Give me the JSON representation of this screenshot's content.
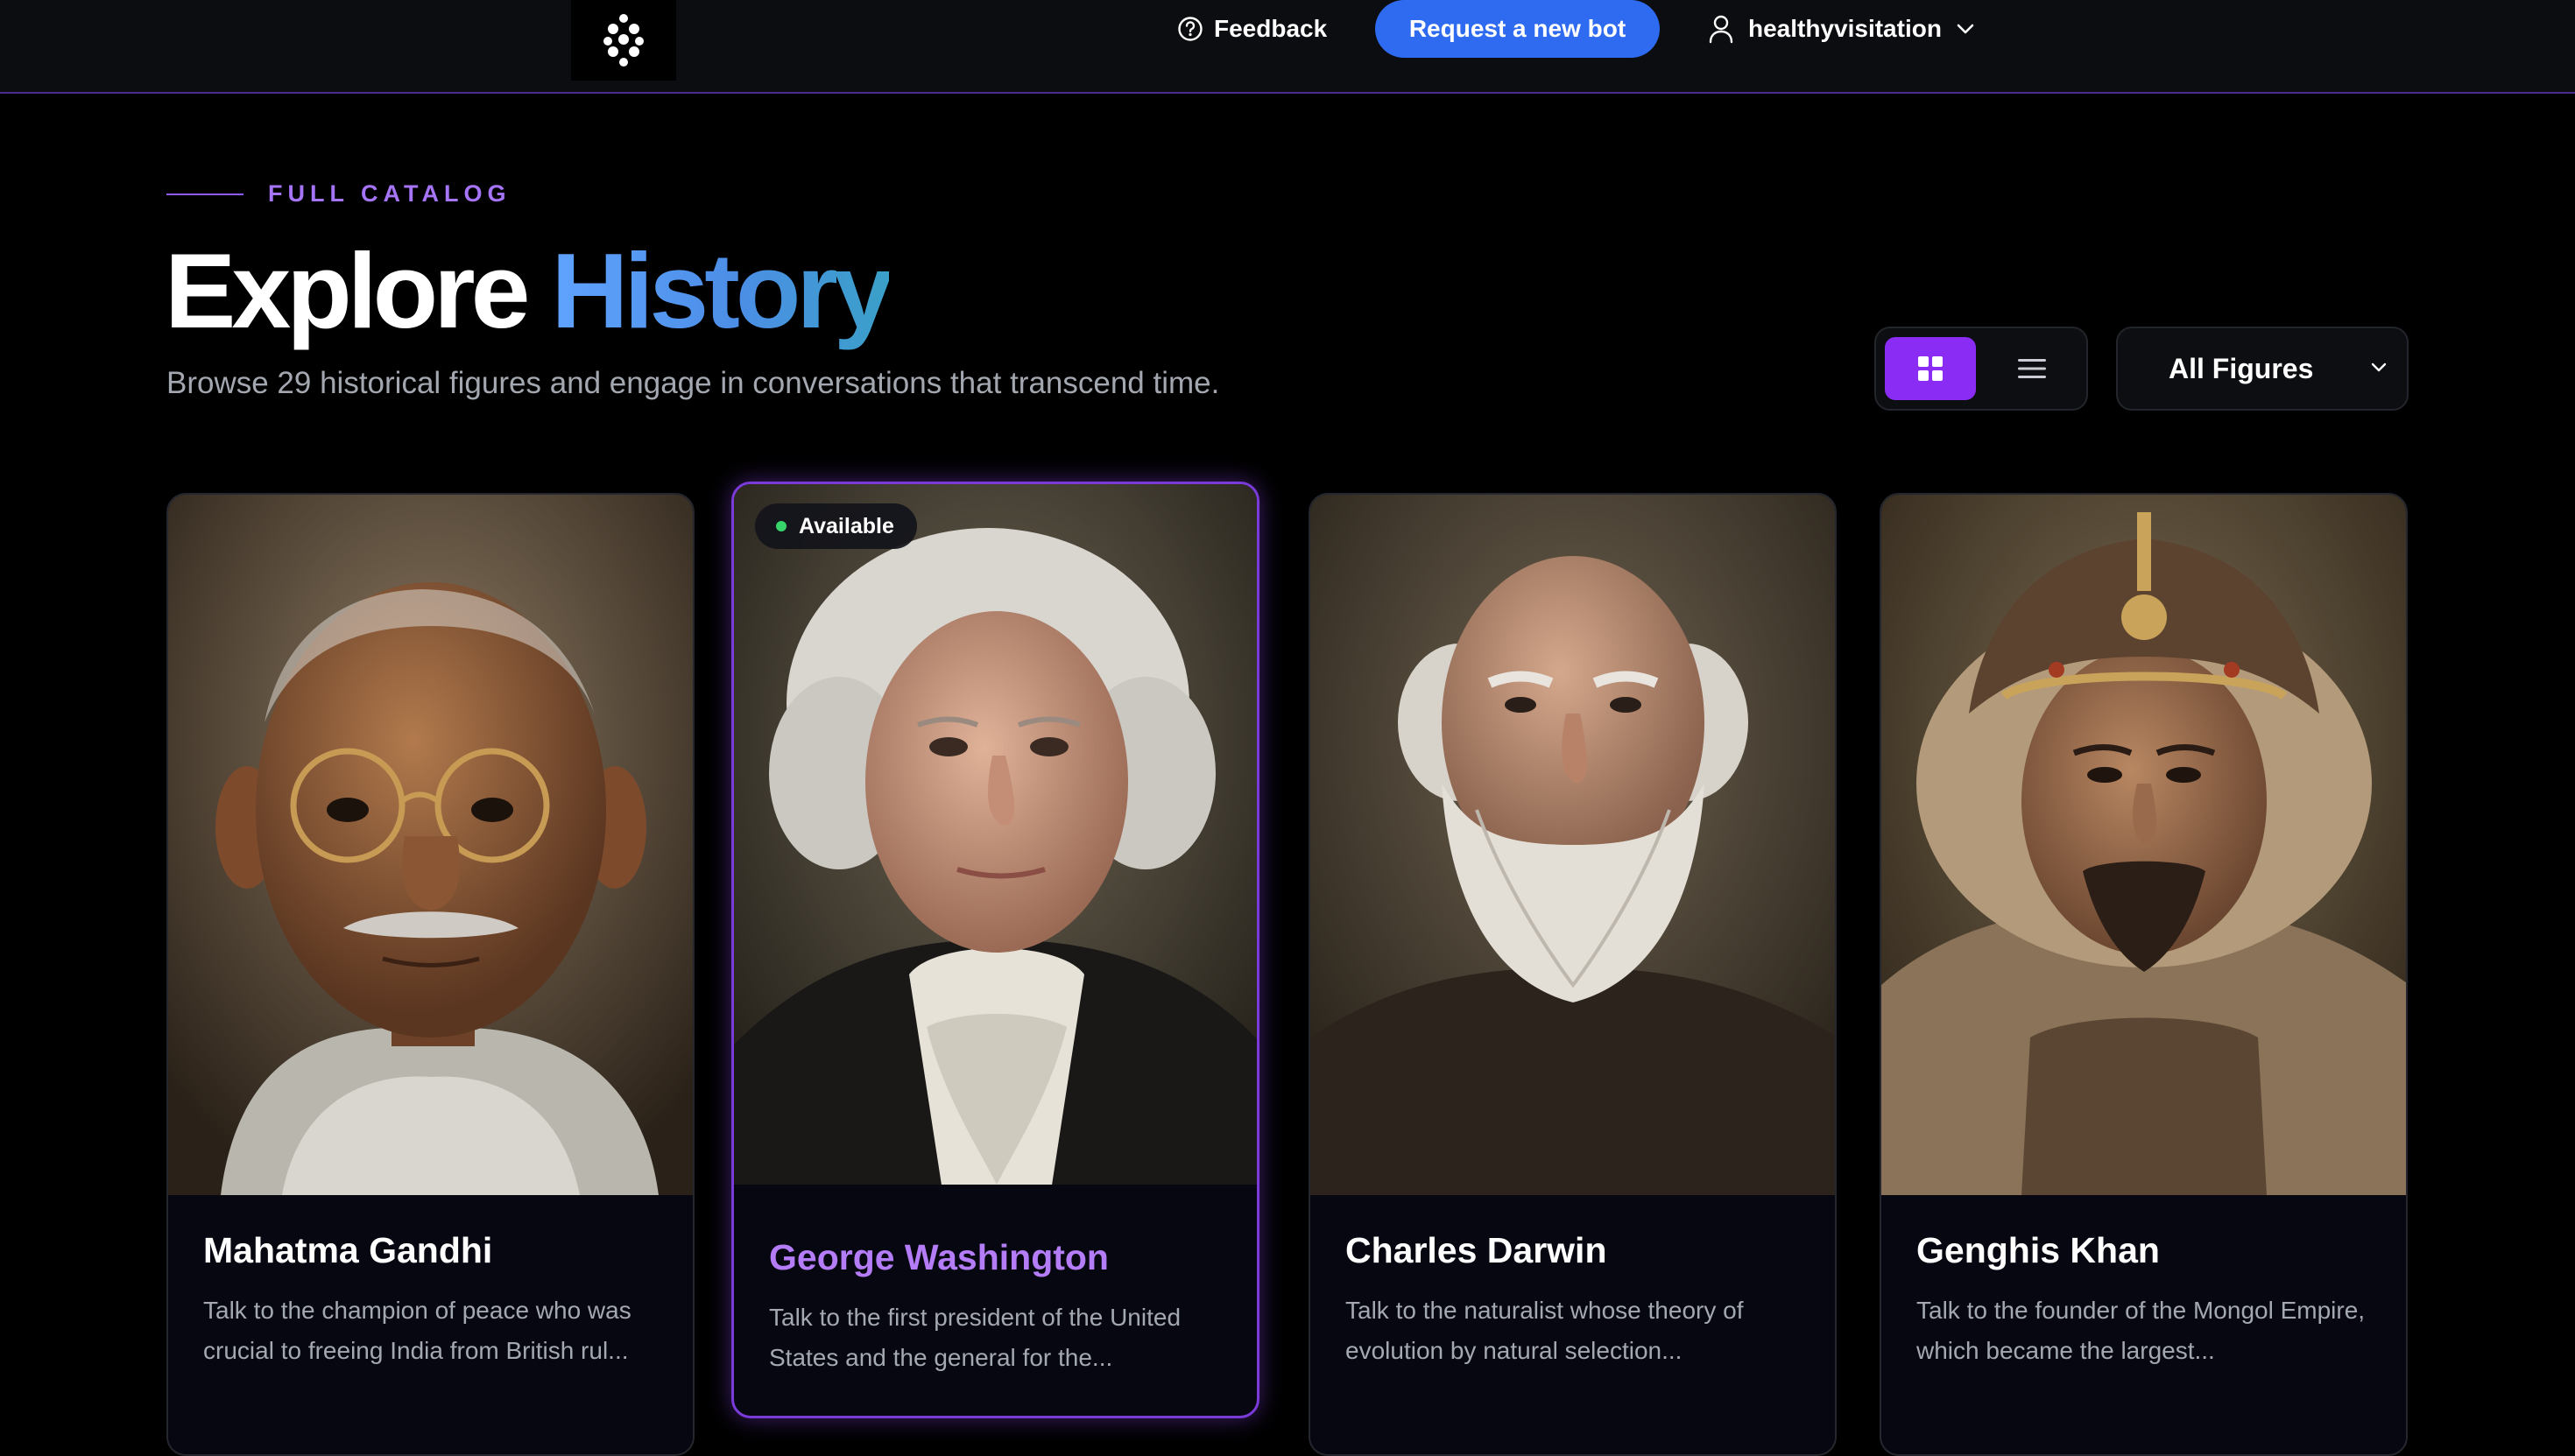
{
  "nav": {
    "logo_icon": "dots-cluster-logo",
    "feedback_label": "Feedback",
    "feedback_icon": "question-circle-icon",
    "request_button_label": "Request a new bot",
    "username": "healthyvisitation",
    "user_icon": "user-icon",
    "accent_color": "#2f6bf0"
  },
  "header": {
    "eyebrow": "FULL CATALOG",
    "title_main": "Explore",
    "title_accent": "History",
    "subtitle": "Browse 29 historical figures and engage in conversations that transcend time."
  },
  "controls": {
    "grid_view_icon": "grid-icon",
    "list_view_icon": "list-icon",
    "active_view": "grid",
    "filter_selected": "All Figures"
  },
  "cards": [
    {
      "name": "Mahatma Gandhi",
      "description": "Talk to the champion of peace who was crucial to freeing India from British rul..."
    },
    {
      "name": "George Washington",
      "description": "Talk to the first president of the United States and the general for the...",
      "badge": "Available",
      "badge_color": "#37d46b",
      "highlight_color": "#b47cf6"
    },
    {
      "name": "Charles Darwin",
      "description": "Talk to the naturalist whose theory of evolution by natural selection..."
    },
    {
      "name": "Genghis Khan",
      "description": "Talk to the founder of the Mongol Empire, which became the largest..."
    }
  ]
}
